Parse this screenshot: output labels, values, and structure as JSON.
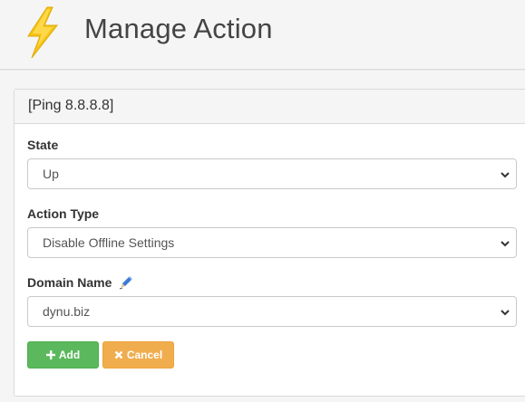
{
  "header": {
    "title": "Manage Action"
  },
  "panel": {
    "heading": "[Ping 8.8.8.8]"
  },
  "form": {
    "state": {
      "label": "State",
      "value": "Up"
    },
    "action_type": {
      "label": "Action Type",
      "value": "Disable Offline Settings"
    },
    "domain_name": {
      "label": "Domain Name",
      "value": "dynu.biz"
    }
  },
  "buttons": {
    "add": "Add",
    "cancel": "Cancel"
  },
  "icons": {
    "logo": "lightning-bolt-icon",
    "edit": "pencil-icon",
    "add": "plus-icon",
    "cancel": "x-icon",
    "select": "chevron-down-icon"
  },
  "colors": {
    "add_button": "#5cb85c",
    "cancel_button": "#f0ad4e",
    "bolt": "#f5c518"
  }
}
